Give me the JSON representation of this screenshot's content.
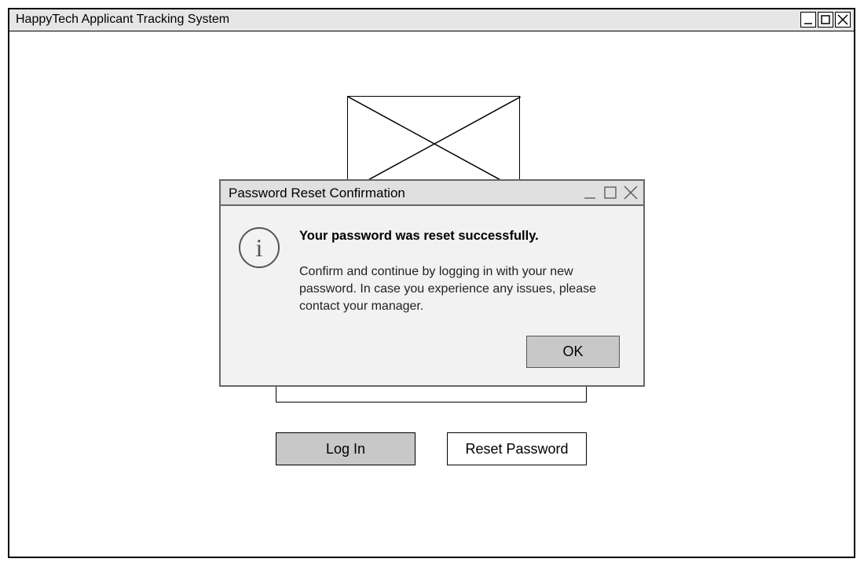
{
  "window": {
    "title": "HappyTech Applicant Tracking System",
    "controls": {
      "minimize_icon": "minimize-icon",
      "maximize_icon": "maximize-icon",
      "close_icon": "close-icon"
    }
  },
  "main": {
    "login_button": "Log In",
    "reset_password_button": "Reset Password"
  },
  "dialog": {
    "title": "Password Reset Confirmation",
    "icon": "info-icon",
    "heading": "Your password was reset successfully.",
    "message": "Confirm and continue by logging in with your new password. In case you experience any issues, please contact your manager.",
    "ok_button": "OK"
  },
  "colors": {
    "button_fill": "#c8c8c8",
    "titlebar_fill": "#e6e6e6",
    "dialog_border": "#666666"
  }
}
